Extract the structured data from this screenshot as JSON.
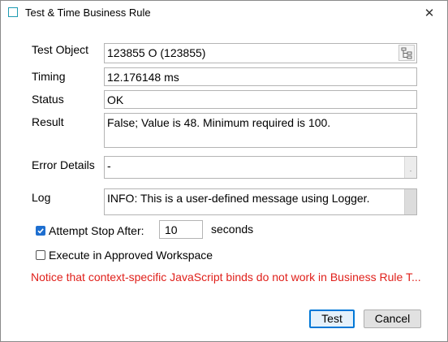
{
  "window": {
    "title": "Test & Time Business Rule",
    "close_glyph": "✕",
    "icon": "window-frame-icon"
  },
  "form": {
    "test_object": {
      "label": "Test Object",
      "value": "123855 O (123855)",
      "button_icon": "tree-structure-icon"
    },
    "timing": {
      "label": "Timing",
      "value": "12.176148 ms"
    },
    "status": {
      "label": "Status",
      "value": "OK"
    },
    "result": {
      "label": "Result",
      "value": "False; Value is 48. Minimum required is 100."
    },
    "error_details": {
      "label": "Error Details",
      "value": "-",
      "side_glyph": "."
    },
    "log": {
      "label": "Log",
      "value": "INFO: This is a user-defined message using Logger."
    }
  },
  "options": {
    "attempt_stop": {
      "label": "Attempt Stop After:",
      "checked": true,
      "value": "10",
      "unit": "seconds"
    },
    "approved_workspace": {
      "label": "Execute in Approved Workspace",
      "checked": false
    }
  },
  "notice": "Notice that context-specific JavaScript binds do not work in Business Rule T...",
  "buttons": {
    "test": "Test",
    "cancel": "Cancel"
  },
  "colors": {
    "accent": "#0078d7",
    "checkbox": "#1e6fd0",
    "notice": "#e0201b",
    "title_icon": "#1e9bb2"
  }
}
